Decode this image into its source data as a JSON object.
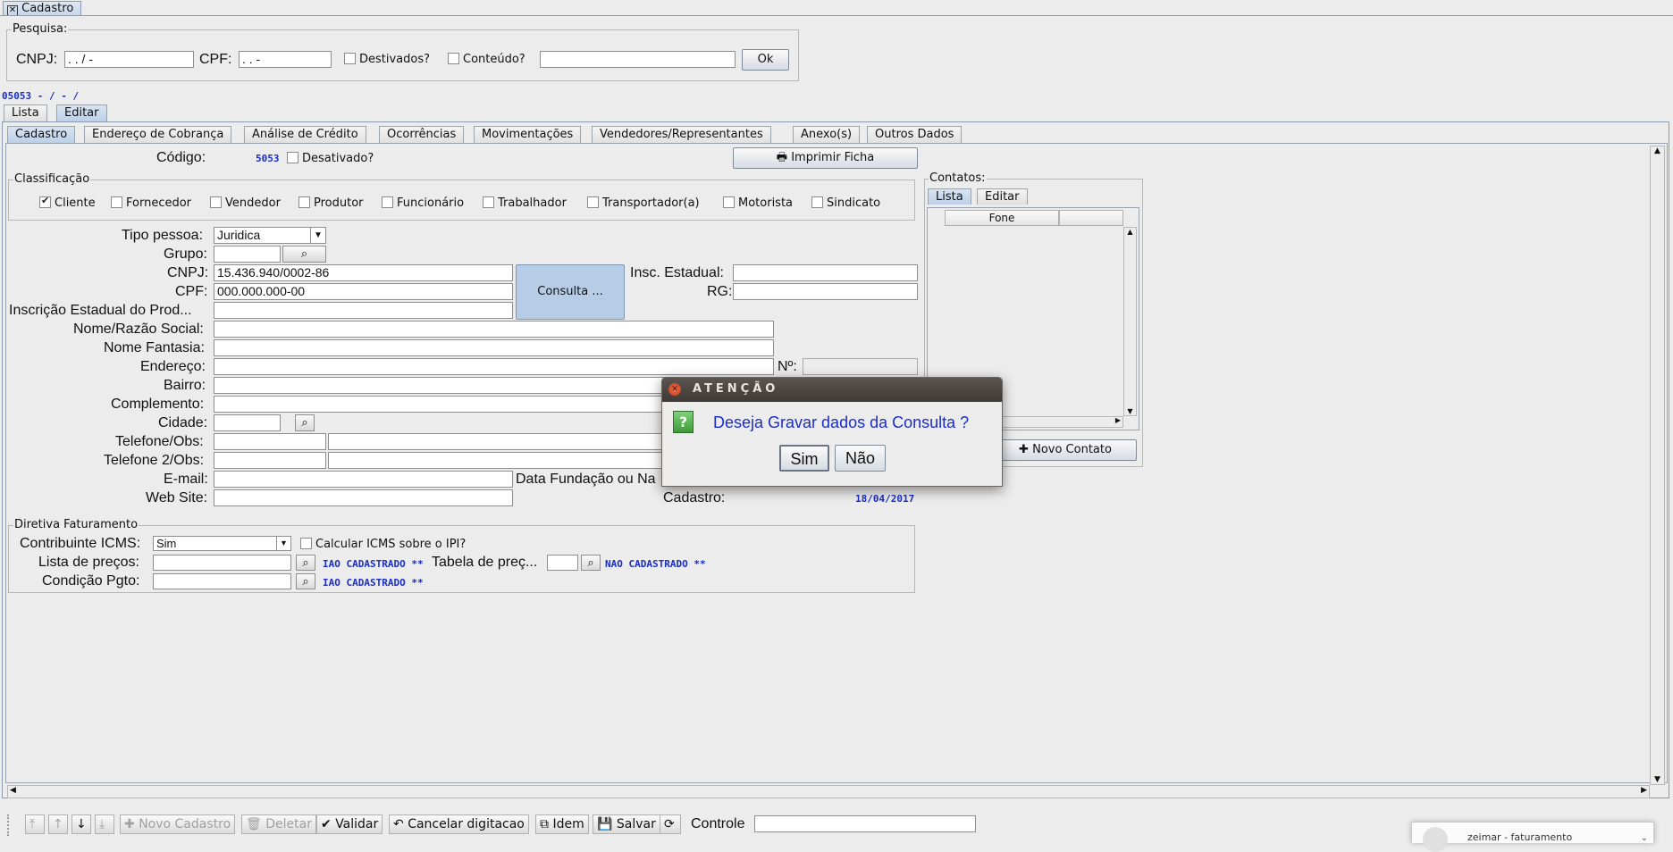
{
  "window": {
    "tab_title": "Cadastro"
  },
  "search": {
    "title": "Pesquisa:",
    "cnpj_label": "CNPJ:",
    "cnpj_value": " .  .  /    -",
    "cpf_label": "CPF:",
    "cpf_value": " .  .  -",
    "destivados_label": "Destivados?",
    "conteudo_label": "Conteúdo?",
    "ok_label": "Ok"
  },
  "record_line": "05053 -  /  - /",
  "view_tabs": [
    "Lista",
    "Editar"
  ],
  "sub_tabs": [
    "Cadastro",
    "Endereço de Cobrança",
    "Análise de Crédito",
    "Ocorrências",
    "Movimentações",
    "Vendedores/Representantes",
    "Anexo(s)",
    "Outros Dados"
  ],
  "form": {
    "codigo_label": "Código:",
    "codigo_value": "5053",
    "desativado_label": "Desativado?",
    "print_button": "Imprimir Ficha",
    "classificacao_title": "Classificação",
    "classificacao": [
      {
        "label": "Cliente",
        "checked": true
      },
      {
        "label": "Fornecedor",
        "checked": false
      },
      {
        "label": "Vendedor",
        "checked": false
      },
      {
        "label": "Produtor",
        "checked": false
      },
      {
        "label": "Funcionário",
        "checked": false
      },
      {
        "label": "Trabalhador",
        "checked": false
      },
      {
        "label": "Transportador(a)",
        "checked": false
      },
      {
        "label": "Motorista",
        "checked": false
      },
      {
        "label": "Sindicato",
        "checked": false
      }
    ],
    "tipo_pessoa_label": "Tipo pessoa:",
    "tipo_pessoa_value": "Juridica",
    "grupo_label": "Grupo:",
    "cnpj_label": "CNPJ:",
    "cnpj_value": "15.436.940/0002-86",
    "cpf_label": "CPF:",
    "cpf_value": "000.000.000-00",
    "consulta_button": "Consulta ...",
    "insc_estadual_label": "Insc. Estadual:",
    "rg_label": "RG:",
    "insc_produtor_label": "Inscrição Estadual do  Prod...",
    "nome_label": "Nome/Razão Social:",
    "fantasia_label": "Nome Fantasia:",
    "endereco_label": "Endereço:",
    "numero_label": "Nº:",
    "bairro_label": "Bairro:",
    "complemento_label": "Complemento:",
    "cidade_label": "Cidade:",
    "telefone_label": "Telefone/Obs:",
    "telefone2_label": "Telefone 2/Obs:",
    "email_label": "E-mail:",
    "data_fundacao_label": "Data Fundação ou Na",
    "website_label": "Web Site:",
    "cadastro_label": "Cadastro:",
    "cadastro_value": "18/04/2017"
  },
  "contacts": {
    "title": "Contatos:",
    "tabs": [
      "Lista",
      "Editar"
    ],
    "column": "Fone",
    "new_button": "Novo Contato"
  },
  "billing": {
    "title": "Diretiva Faturamento",
    "icms_label": "Contribuinte ICMS:",
    "icms_value": "Sim",
    "calc_icms_label": "Calcular ICMS sobre o IPI?",
    "lista_precos_label": "Lista de preços:",
    "lista_status": "IAO CADASTRADO  **",
    "tabela_precos_label": "Tabela de preç...",
    "tabela_status": "NAO CADASTRADO  **",
    "condicao_label": "Condição Pgto:",
    "condicao_status": "IAO CADASTRADO  **"
  },
  "dialog": {
    "title": "ATENÇÃO",
    "message": "Deseja Gravar dados da Consulta ?",
    "yes": "Sim",
    "no": "Não"
  },
  "toolbar": {
    "novo": "Novo Cadastro",
    "deletar": "Deletar",
    "validar": "Validar",
    "cancelar": "Cancelar digitacao",
    "idem": "Idem",
    "salvar": "Salvar",
    "controle_label": "Controle"
  },
  "notification": {
    "text": "zeimar - faturamento"
  },
  "colors": {
    "blue_text": "#1a2dc7",
    "selected_tab": "#bcd0e8",
    "dialog_title": "#4a4540"
  }
}
